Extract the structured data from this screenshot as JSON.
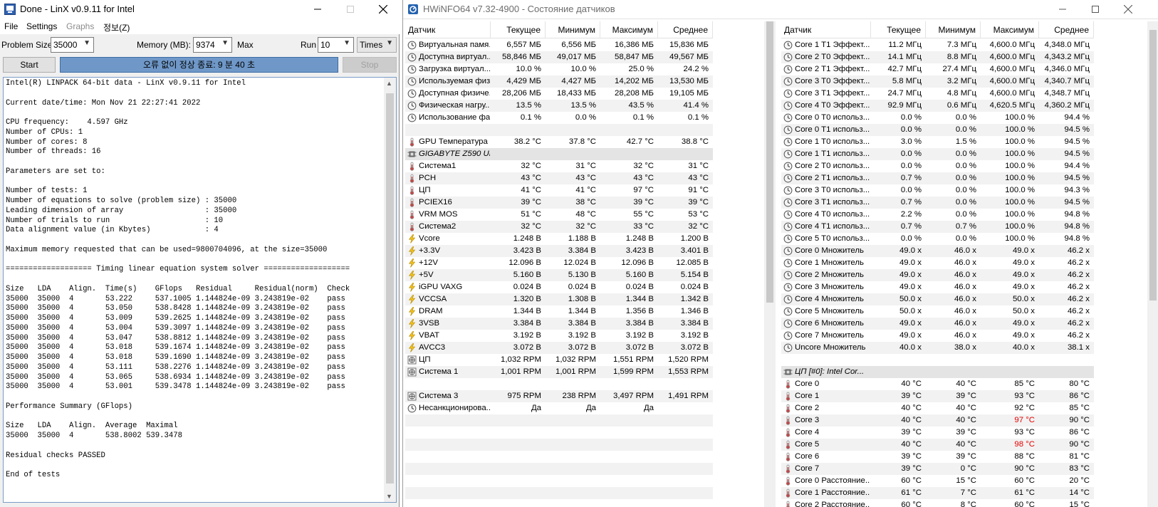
{
  "linx": {
    "title": "Done - LinX v0.9.11 for Intel",
    "menu": [
      "File",
      "Settings",
      "Graphs",
      "정보(Z)"
    ],
    "problem_size_label": "Problem Size:",
    "problem_size_value": "35000",
    "memory_label": "Memory (MB):",
    "memory_value": "9374",
    "max_label": "Max",
    "run_label": "Run",
    "run_value": "10",
    "times_value": "Times",
    "start_label": "Start",
    "status_text": "오류 없이 정상 종료: 9 분 40 초",
    "stop_label": "Stop",
    "output_lines": [
      "Intel(R) LINPACK 64-bit data - LinX v0.9.11 for Intel",
      "",
      "Current date/time: Mon Nov 21 22:27:41 2022",
      "",
      "CPU frequency:    4.597 GHz",
      "Number of CPUs: 1",
      "Number of cores: 8",
      "Number of threads: 16",
      "",
      "Parameters are set to:",
      "",
      "Number of tests: 1",
      "Number of equations to solve (problem size) : 35000",
      "Leading dimension of array                  : 35000",
      "Number of trials to run                     : 10",
      "Data alignment value (in Kbytes)            : 4",
      "",
      "Maximum memory requested that can be used=9800704096, at the size=35000",
      "",
      "=================== Timing linear equation system solver ===================",
      "",
      "Size   LDA    Align.  Time(s)    GFlops   Residual     Residual(norm)  Check",
      "35000  35000  4       53.222     537.1005 1.144824e-09 3.243819e-02    pass",
      "35000  35000  4       53.050     538.8428 1.144824e-09 3.243819e-02    pass",
      "35000  35000  4       53.009     539.2625 1.144824e-09 3.243819e-02    pass",
      "35000  35000  4       53.004     539.3097 1.144824e-09 3.243819e-02    pass",
      "35000  35000  4       53.047     538.8812 1.144824e-09 3.243819e-02    pass",
      "35000  35000  4       53.018     539.1674 1.144824e-09 3.243819e-02    pass",
      "35000  35000  4       53.018     539.1690 1.144824e-09 3.243819e-02    pass",
      "35000  35000  4       53.111     538.2276 1.144824e-09 3.243819e-02    pass",
      "35000  35000  4       53.065     538.6934 1.144824e-09 3.243819e-02    pass",
      "35000  35000  4       53.001     539.3478 1.144824e-09 3.243819e-02    pass",
      "",
      "Performance Summary (GFlops)",
      "",
      "Size   LDA    Align.  Average  Maximal",
      "35000  35000  4       538.8002 539.3478",
      "",
      "Residual checks PASSED",
      "",
      "End of tests"
    ]
  },
  "hwinfo": {
    "title": "HWiNFO64 v7.32-4900 - Состояние датчиков",
    "headers": [
      "Датчик",
      "Текущее",
      "Минимум",
      "Максимум",
      "Среднее"
    ],
    "left_rows": [
      {
        "icon": "clock-icon",
        "name": "Виртуальная памя...",
        "cur": "6,557 МБ",
        "min": "6,556 МБ",
        "max": "16,386 МБ",
        "avg": "15,836 МБ"
      },
      {
        "icon": "clock-icon",
        "name": "Доступна виртуал...",
        "cur": "58,846 МБ",
        "min": "49,017 МБ",
        "max": "58,847 МБ",
        "avg": "49,567 МБ"
      },
      {
        "icon": "clock-icon",
        "name": "Загрузка виртуал...",
        "cur": "10.0 %",
        "min": "10.0 %",
        "max": "25.0 %",
        "avg": "24.2 %"
      },
      {
        "icon": "clock-icon",
        "name": "Используемая физ...",
        "cur": "4,429 МБ",
        "min": "4,427 МБ",
        "max": "14,202 МБ",
        "avg": "13,530 МБ"
      },
      {
        "icon": "clock-icon",
        "name": "Доступная физиче...",
        "cur": "28,206 МБ",
        "min": "18,433 МБ",
        "max": "28,208 МБ",
        "avg": "19,105 МБ"
      },
      {
        "icon": "clock-icon",
        "name": "Физическая нагру...",
        "cur": "13.5 %",
        "min": "13.5 %",
        "max": "43.5 %",
        "avg": "41.4 %"
      },
      {
        "icon": "clock-icon",
        "name": "Использование фа...",
        "cur": "0.1 %",
        "min": "0.0 %",
        "max": "0.1 %",
        "avg": "0.1 %"
      },
      {
        "icon": "",
        "name": "",
        "cur": "",
        "min": "",
        "max": "",
        "avg": ""
      },
      {
        "icon": "thermometer-icon",
        "name": "GPU Температура",
        "cur": "38.2 °C",
        "min": "37.8 °C",
        "max": "42.7 °C",
        "avg": "38.8 °C"
      },
      {
        "icon": "chip-icon",
        "name": "GIGABYTE Z590 UD...",
        "cur": "",
        "min": "",
        "max": "",
        "avg": "",
        "group": true
      },
      {
        "icon": "thermometer-icon",
        "name": "Система1",
        "cur": "32 °C",
        "min": "31 °C",
        "max": "32 °C",
        "avg": "31 °C"
      },
      {
        "icon": "thermometer-icon",
        "name": "PCH",
        "cur": "43 °C",
        "min": "43 °C",
        "max": "43 °C",
        "avg": "43 °C"
      },
      {
        "icon": "thermometer-icon",
        "name": "ЦП",
        "cur": "41 °C",
        "min": "41 °C",
        "max": "97 °C",
        "avg": "91 °C"
      },
      {
        "icon": "thermometer-icon",
        "name": "PCIEX16",
        "cur": "39 °C",
        "min": "38 °C",
        "max": "39 °C",
        "avg": "39 °C"
      },
      {
        "icon": "thermometer-icon",
        "name": "VRM MOS",
        "cur": "51 °C",
        "min": "48 °C",
        "max": "55 °C",
        "avg": "53 °C"
      },
      {
        "icon": "thermometer-icon",
        "name": "Система2",
        "cur": "32 °C",
        "min": "32 °C",
        "max": "33 °C",
        "avg": "32 °C"
      },
      {
        "icon": "lightning-icon",
        "name": "Vcore",
        "cur": "1.248 В",
        "min": "1.188 В",
        "max": "1.248 В",
        "avg": "1.200 В"
      },
      {
        "icon": "lightning-icon",
        "name": "+3.3V",
        "cur": "3.423 В",
        "min": "3.384 В",
        "max": "3.423 В",
        "avg": "3.401 В"
      },
      {
        "icon": "lightning-icon",
        "name": "+12V",
        "cur": "12.096 В",
        "min": "12.024 В",
        "max": "12.096 В",
        "avg": "12.085 В"
      },
      {
        "icon": "lightning-icon",
        "name": "+5V",
        "cur": "5.160 В",
        "min": "5.130 В",
        "max": "5.160 В",
        "avg": "5.154 В"
      },
      {
        "icon": "lightning-icon",
        "name": "iGPU VAXG",
        "cur": "0.024 В",
        "min": "0.024 В",
        "max": "0.024 В",
        "avg": "0.024 В"
      },
      {
        "icon": "lightning-icon",
        "name": "VCCSA",
        "cur": "1.320 В",
        "min": "1.308 В",
        "max": "1.344 В",
        "avg": "1.342 В"
      },
      {
        "icon": "lightning-icon",
        "name": "DRAM",
        "cur": "1.344 В",
        "min": "1.344 В",
        "max": "1.356 В",
        "avg": "1.346 В"
      },
      {
        "icon": "lightning-icon",
        "name": "3VSB",
        "cur": "3.384 В",
        "min": "3.384 В",
        "max": "3.384 В",
        "avg": "3.384 В"
      },
      {
        "icon": "lightning-icon",
        "name": "VBAT",
        "cur": "3.192 В",
        "min": "3.192 В",
        "max": "3.192 В",
        "avg": "3.192 В"
      },
      {
        "icon": "lightning-icon",
        "name": "AVCC3",
        "cur": "3.072 В",
        "min": "3.072 В",
        "max": "3.072 В",
        "avg": "3.072 В"
      },
      {
        "icon": "fan-icon",
        "name": "ЦП",
        "cur": "1,032 RPM",
        "min": "1,032 RPM",
        "max": "1,551 RPM",
        "avg": "1,520 RPM"
      },
      {
        "icon": "fan-icon",
        "name": "Система 1",
        "cur": "1,001 RPM",
        "min": "1,001 RPM",
        "max": "1,599 RPM",
        "avg": "1,553 RPM"
      },
      {
        "icon": "",
        "name": "",
        "cur": "",
        "min": "",
        "max": "",
        "avg": ""
      },
      {
        "icon": "fan-icon",
        "name": "Система 3",
        "cur": "975 RPM",
        "min": "238 RPM",
        "max": "3,497 RPM",
        "avg": "1,491 RPM"
      },
      {
        "icon": "clock-icon",
        "name": "Несанкционирова...",
        "cur": "Да",
        "min": "Да",
        "max": "Да",
        "avg": ""
      },
      {
        "icon": "",
        "name": "",
        "cur": "",
        "min": "",
        "max": "",
        "avg": ""
      },
      {
        "icon": "",
        "name": "",
        "cur": "",
        "min": "",
        "max": "",
        "avg": ""
      },
      {
        "icon": "",
        "name": "",
        "cur": "",
        "min": "",
        "max": "",
        "avg": ""
      },
      {
        "icon": "",
        "name": "",
        "cur": "",
        "min": "",
        "max": "",
        "avg": ""
      },
      {
        "icon": "",
        "name": "",
        "cur": "",
        "min": "",
        "max": "",
        "avg": ""
      },
      {
        "icon": "",
        "name": "",
        "cur": "",
        "min": "",
        "max": "",
        "avg": ""
      },
      {
        "icon": "",
        "name": "",
        "cur": "",
        "min": "",
        "max": "",
        "avg": ""
      },
      {
        "icon": "",
        "name": "",
        "cur": "",
        "min": "",
        "max": "",
        "avg": ""
      }
    ],
    "right_rows": [
      {
        "icon": "clock-icon",
        "name": "Core 1 T1 Эффект...",
        "cur": "11.2 МГц",
        "min": "7.3 МГц",
        "max": "4,600.0 МГц",
        "avg": "4,348.0 МГц"
      },
      {
        "icon": "clock-icon",
        "name": "Core 2 T0 Эффект...",
        "cur": "14.1 МГц",
        "min": "8.8 МГц",
        "max": "4,600.0 МГц",
        "avg": "4,343.2 МГц"
      },
      {
        "icon": "clock-icon",
        "name": "Core 2 T1 Эффект...",
        "cur": "42.7 МГц",
        "min": "27.4 МГц",
        "max": "4,600.0 МГц",
        "avg": "4,346.0 МГц"
      },
      {
        "icon": "clock-icon",
        "name": "Core 3 T0 Эффект...",
        "cur": "5.8 МГц",
        "min": "3.2 МГц",
        "max": "4,600.0 МГц",
        "avg": "4,340.7 МГц"
      },
      {
        "icon": "clock-icon",
        "name": "Core 3 T1 Эффект...",
        "cur": "24.7 МГц",
        "min": "4.8 МГц",
        "max": "4,600.0 МГц",
        "avg": "4,348.7 МГц"
      },
      {
        "icon": "clock-icon",
        "name": "Core 4 T0 Эффект...",
        "cur": "92.9 МГц",
        "min": "0.6 МГц",
        "max": "4,620.5 МГц",
        "avg": "4,360.2 МГц"
      },
      {
        "icon": "clock-icon",
        "name": "Core 0 T0 использ...",
        "cur": "0.0 %",
        "min": "0.0 %",
        "max": "100.0 %",
        "avg": "94.4 %"
      },
      {
        "icon": "clock-icon",
        "name": "Core 0 T1 использ...",
        "cur": "0.0 %",
        "min": "0.0 %",
        "max": "100.0 %",
        "avg": "94.5 %"
      },
      {
        "icon": "clock-icon",
        "name": "Core 1 T0 использ...",
        "cur": "3.0 %",
        "min": "1.5 %",
        "max": "100.0 %",
        "avg": "94.5 %"
      },
      {
        "icon": "clock-icon",
        "name": "Core 1 T1 использ...",
        "cur": "0.0 %",
        "min": "0.0 %",
        "max": "100.0 %",
        "avg": "94.5 %"
      },
      {
        "icon": "clock-icon",
        "name": "Core 2 T0 использ...",
        "cur": "0.0 %",
        "min": "0.0 %",
        "max": "100.0 %",
        "avg": "94.4 %"
      },
      {
        "icon": "clock-icon",
        "name": "Core 2 T1 использ...",
        "cur": "0.7 %",
        "min": "0.0 %",
        "max": "100.0 %",
        "avg": "94.5 %"
      },
      {
        "icon": "clock-icon",
        "name": "Core 3 T0 использ...",
        "cur": "0.0 %",
        "min": "0.0 %",
        "max": "100.0 %",
        "avg": "94.3 %"
      },
      {
        "icon": "clock-icon",
        "name": "Core 3 T1 использ...",
        "cur": "0.7 %",
        "min": "0.0 %",
        "max": "100.0 %",
        "avg": "94.5 %"
      },
      {
        "icon": "clock-icon",
        "name": "Core 4 T0 использ...",
        "cur": "2.2 %",
        "min": "0.0 %",
        "max": "100.0 %",
        "avg": "94.8 %"
      },
      {
        "icon": "clock-icon",
        "name": "Core 4 T1 использ...",
        "cur": "0.7 %",
        "min": "0.7 %",
        "max": "100.0 %",
        "avg": "94.8 %"
      },
      {
        "icon": "clock-icon",
        "name": "Core 5 T0 использ...",
        "cur": "0.0 %",
        "min": "0.0 %",
        "max": "100.0 %",
        "avg": "94.8 %"
      },
      {
        "icon": "clock-icon",
        "name": "Core 0 Множитель",
        "cur": "49.0 x",
        "min": "46.0 x",
        "max": "49.0 x",
        "avg": "46.2 x"
      },
      {
        "icon": "clock-icon",
        "name": "Core 1 Множитель",
        "cur": "49.0 x",
        "min": "46.0 x",
        "max": "49.0 x",
        "avg": "46.2 x"
      },
      {
        "icon": "clock-icon",
        "name": "Core 2 Множитель",
        "cur": "49.0 x",
        "min": "46.0 x",
        "max": "49.0 x",
        "avg": "46.2 x"
      },
      {
        "icon": "clock-icon",
        "name": "Core 3 Множитель",
        "cur": "49.0 x",
        "min": "46.0 x",
        "max": "49.0 x",
        "avg": "46.2 x"
      },
      {
        "icon": "clock-icon",
        "name": "Core 4 Множитель",
        "cur": "50.0 x",
        "min": "46.0 x",
        "max": "50.0 x",
        "avg": "46.2 x"
      },
      {
        "icon": "clock-icon",
        "name": "Core 5 Множитель",
        "cur": "50.0 x",
        "min": "46.0 x",
        "max": "50.0 x",
        "avg": "46.2 x"
      },
      {
        "icon": "clock-icon",
        "name": "Core 6 Множитель",
        "cur": "49.0 x",
        "min": "46.0 x",
        "max": "49.0 x",
        "avg": "46.2 x"
      },
      {
        "icon": "clock-icon",
        "name": "Core 7 Множитель",
        "cur": "49.0 x",
        "min": "46.0 x",
        "max": "49.0 x",
        "avg": "46.2 x"
      },
      {
        "icon": "clock-icon",
        "name": "Uncore Множитель",
        "cur": "40.0 x",
        "min": "38.0 x",
        "max": "40.0 x",
        "avg": "38.1 x"
      },
      {
        "icon": "",
        "name": "",
        "cur": "",
        "min": "",
        "max": "",
        "avg": ""
      },
      {
        "icon": "chip-icon",
        "name": "ЦП [#0]: Intel Cor...",
        "cur": "",
        "min": "",
        "max": "",
        "avg": "",
        "group": true
      },
      {
        "icon": "thermometer-icon",
        "name": "Core 0",
        "cur": "40 °C",
        "min": "40 °C",
        "max": "85 °C",
        "avg": "80 °C"
      },
      {
        "icon": "thermometer-icon",
        "name": "Core 1",
        "cur": "39 °C",
        "min": "39 °C",
        "max": "93 °C",
        "avg": "86 °C"
      },
      {
        "icon": "thermometer-icon",
        "name": "Core 2",
        "cur": "40 °C",
        "min": "40 °C",
        "max": "92 °C",
        "avg": "85 °C"
      },
      {
        "icon": "thermometer-icon",
        "name": "Core 3",
        "cur": "40 °C",
        "min": "40 °C",
        "max": "97 °C",
        "avg": "90 °C",
        "max_alert": true
      },
      {
        "icon": "thermometer-icon",
        "name": "Core 4",
        "cur": "39 °C",
        "min": "39 °C",
        "max": "93 °C",
        "avg": "86 °C"
      },
      {
        "icon": "thermometer-icon",
        "name": "Core 5",
        "cur": "40 °C",
        "min": "40 °C",
        "max": "98 °C",
        "avg": "90 °C",
        "max_alert": true
      },
      {
        "icon": "thermometer-icon",
        "name": "Core 6",
        "cur": "39 °C",
        "min": "39 °C",
        "max": "88 °C",
        "avg": "81 °C"
      },
      {
        "icon": "thermometer-icon",
        "name": "Core 7",
        "cur": "39 °C",
        "min": "0 °C",
        "max": "90 °C",
        "avg": "83 °C"
      },
      {
        "icon": "thermometer-icon",
        "name": "Core 0 Расстояние...",
        "cur": "60 °C",
        "min": "15 °C",
        "max": "60 °C",
        "avg": "20 °C"
      },
      {
        "icon": "thermometer-icon",
        "name": "Core 1 Расстояние...",
        "cur": "61 °C",
        "min": "7 °C",
        "max": "61 °C",
        "avg": "14 °C"
      },
      {
        "icon": "thermometer-icon",
        "name": "Core 2 Расстояние...",
        "cur": "60 °C",
        "min": "8 °C",
        "max": "60 °C",
        "avg": "15 °C"
      }
    ],
    "colors": {
      "alert": "#e60000",
      "progress": "#6f98c8",
      "group_row": "#e4e4e4"
    }
  }
}
